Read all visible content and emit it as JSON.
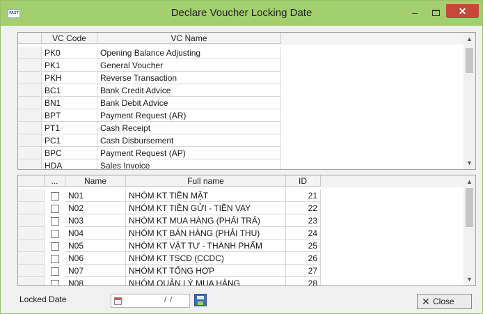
{
  "window": {
    "title": "Declare Voucher Locking Date",
    "app_icon": "FAST",
    "minimize": "–",
    "close": "✕"
  },
  "voucher_table": {
    "columns": [
      "VC Code",
      "VC Name"
    ],
    "rows": [
      {
        "code": "PK0",
        "name": "Opening Balance Adjusting"
      },
      {
        "code": "PK1",
        "name": "General Voucher"
      },
      {
        "code": "PKH",
        "name": "Reverse Transaction"
      },
      {
        "code": "BC1",
        "name": "Bank Credit Advice"
      },
      {
        "code": "BN1",
        "name": "Bank Debit Advice"
      },
      {
        "code": "BPT",
        "name": "Payment Request (AR)"
      },
      {
        "code": "PT1",
        "name": "Cash Receipt"
      },
      {
        "code": "PC1",
        "name": "Cash Disbursement"
      },
      {
        "code": "BPC",
        "name": "Payment Request (AP)"
      },
      {
        "code": "HDA",
        "name": "Sales Invoice"
      }
    ]
  },
  "group_table": {
    "columns": [
      "...",
      "Name",
      "Full name",
      "ID"
    ],
    "rows": [
      {
        "name": "N01",
        "full_name": "NHÓM KT TIỀN MẶT",
        "id": "21"
      },
      {
        "name": "N02",
        "full_name": "NHÓM KT TIỀN GỬI - TIỀN VAY",
        "id": "22"
      },
      {
        "name": "N03",
        "full_name": "NHÓM KT MUA HÀNG (PHẢI TRẢ)",
        "id": "23"
      },
      {
        "name": "N04",
        "full_name": "NHÓM KT BÁN HÀNG (PHẢI THU)",
        "id": "24"
      },
      {
        "name": "N05",
        "full_name": "NHÓM KT VẬT TƯ - THÀNH PHẨM",
        "id": "25"
      },
      {
        "name": "N06",
        "full_name": "NHÓM KT TSCĐ (CCDC)",
        "id": "26"
      },
      {
        "name": "N07",
        "full_name": "NHÓM KT TỔNG HỢP",
        "id": "27"
      },
      {
        "name": "N08",
        "full_name": "NHÓM QUẢN LÝ MUA HÀNG",
        "id": "28"
      }
    ]
  },
  "footer": {
    "locked_date_label": "Locked Date",
    "date_value": "/ /",
    "close_label": "Close",
    "close_glyph": "✕"
  },
  "icons": [
    "calendar-icon",
    "save-icon",
    "close-x-icon",
    "scroll-up-icon",
    "scroll-down-icon"
  ],
  "colors": {
    "titlebar": "#a3cf6e",
    "close_button": "#c7473c"
  }
}
